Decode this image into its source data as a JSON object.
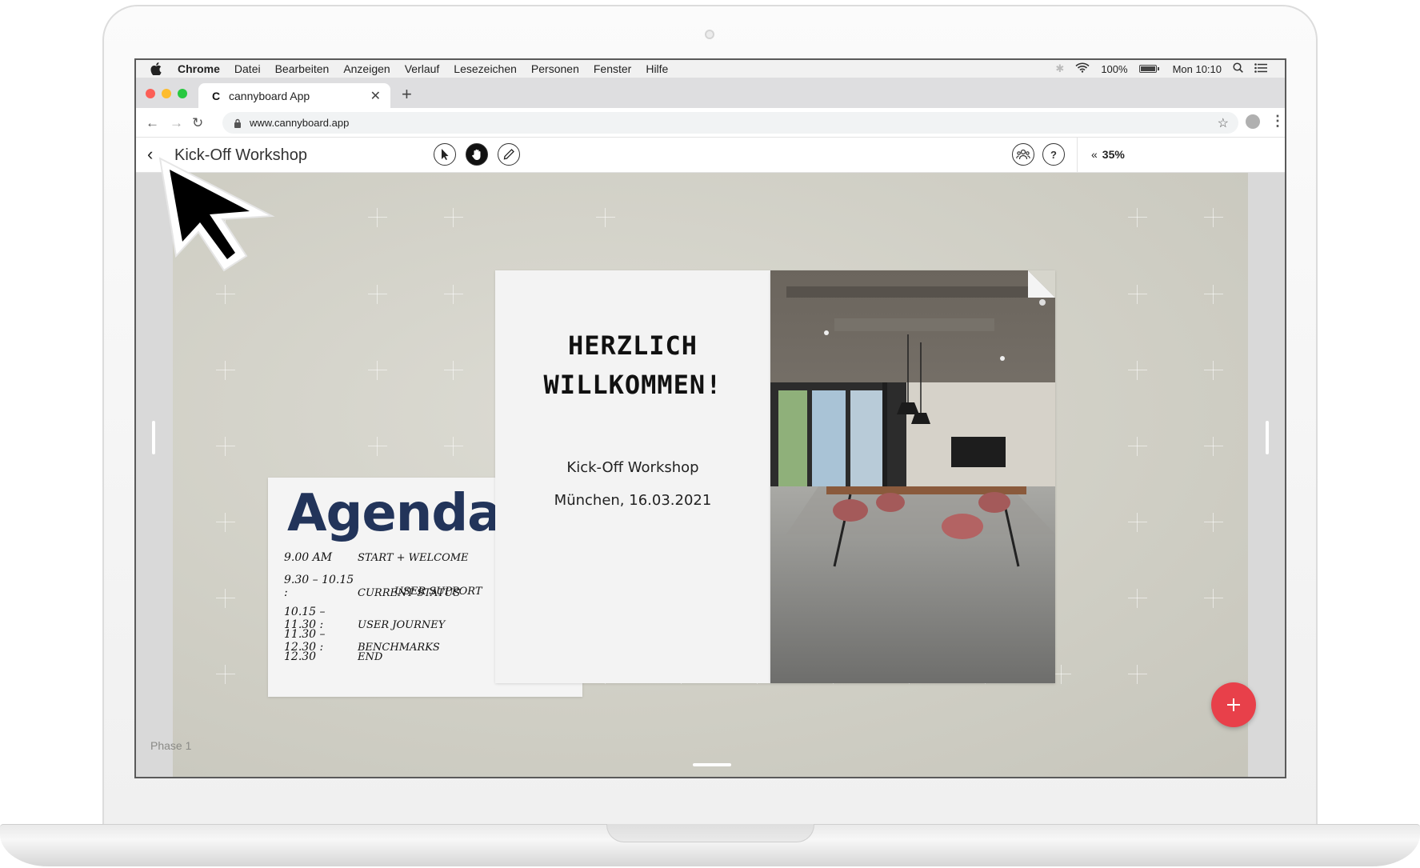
{
  "menubar": {
    "items": [
      "Chrome",
      "Datei",
      "Bearbeiten",
      "Anzeigen",
      "Verlauf",
      "Lesezeichen",
      "Personen",
      "Fenster",
      "Hilfe"
    ],
    "battery": "100%",
    "clock": "Mon 10:10"
  },
  "browser": {
    "tab_title": "cannyboard App",
    "tab_favicon": "C",
    "url": "www.cannyboard.app"
  },
  "toolbar": {
    "title": "Kick-Off Workshop",
    "zoom_value": "35%",
    "zoom_prefix": "«",
    "tools": [
      "select-icon",
      "hand-icon",
      "pen-icon"
    ]
  },
  "canvas": {
    "phase_label": "Phase 1",
    "colors": {
      "accent": "#e8404a",
      "agenda_title": "#22345a",
      "canvas_bg": "#cfcec4"
    }
  },
  "agenda": {
    "title": "Agenda",
    "rows": [
      {
        "time": "9.00 AM",
        "desc": "Start + Welcome"
      },
      {
        "time": "9.30 – 10.15 :",
        "desc": "Current Status"
      },
      {
        "time": "",
        "desc": "User Support"
      },
      {
        "time": "10.15 – 11.30 :",
        "desc": "User Journey"
      },
      {
        "time": "11.30 – 12.30 :",
        "desc": "Benchmarks"
      },
      {
        "time": "12.30",
        "desc": "End"
      }
    ]
  },
  "welcome": {
    "line1": "HERZLICH",
    "line2": "WILLKOMMEN!",
    "subtitle": "Kick-Off Workshop",
    "date": "München, 16.03.2021"
  }
}
